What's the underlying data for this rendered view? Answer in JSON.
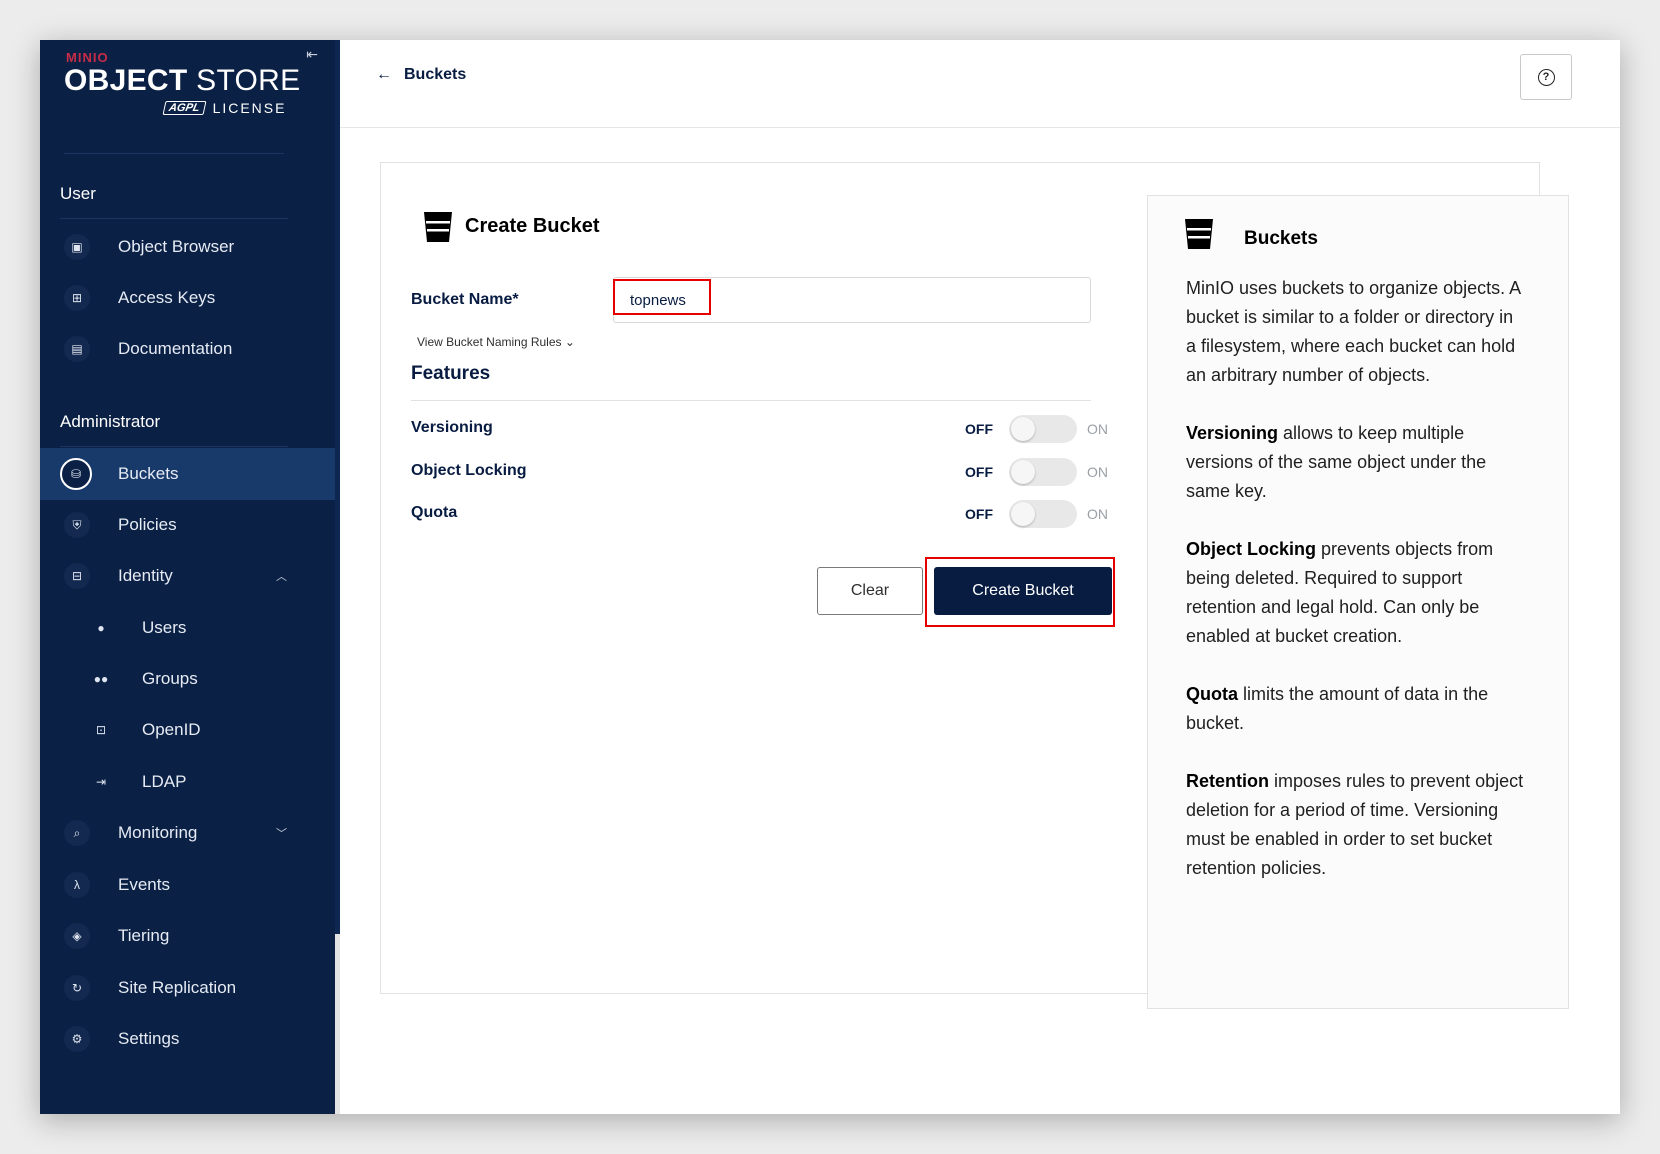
{
  "brand": {
    "minio": "MINIO",
    "object": "OBJECT",
    "store": "STORE",
    "agpl": "AGPL",
    "license": "LICENSE"
  },
  "sidebar": {
    "user_section": "User",
    "admin_section": "Administrator",
    "user_items": [
      {
        "label": "Object Browser",
        "icon": "object-browser-icon"
      },
      {
        "label": "Access Keys",
        "icon": "access-keys-icon"
      },
      {
        "label": "Documentation",
        "icon": "documentation-icon"
      }
    ],
    "admin_items": [
      {
        "label": "Buckets",
        "icon": "bucket-icon",
        "active": true
      },
      {
        "label": "Policies",
        "icon": "shield-icon"
      },
      {
        "label": "Identity",
        "icon": "identity-icon"
      },
      {
        "label": "Users",
        "icon": "user-icon"
      },
      {
        "label": "Groups",
        "icon": "groups-icon"
      },
      {
        "label": "OpenID",
        "icon": "lock-icon"
      },
      {
        "label": "LDAP",
        "icon": "login-icon"
      },
      {
        "label": "Monitoring",
        "icon": "monitoring-icon"
      },
      {
        "label": "Events",
        "icon": "lambda-icon"
      },
      {
        "label": "Tiering",
        "icon": "layers-icon"
      },
      {
        "label": "Site Replication",
        "icon": "replication-icon"
      },
      {
        "label": "Settings",
        "icon": "gear-icon"
      }
    ]
  },
  "header": {
    "back_label": "Buckets"
  },
  "form": {
    "title": "Create Bucket",
    "bucket_name_label": "Bucket Name*",
    "bucket_name_value": "topnews",
    "naming_rules_link": "View Bucket Naming Rules",
    "features_title": "Features",
    "features": [
      {
        "name": "Versioning",
        "off": "OFF",
        "on": "ON",
        "enabled": false
      },
      {
        "name": "Object Locking",
        "off": "OFF",
        "on": "ON",
        "enabled": false
      },
      {
        "name": "Quota",
        "off": "OFF",
        "on": "ON",
        "enabled": false
      }
    ],
    "clear_label": "Clear",
    "create_label": "Create Bucket"
  },
  "help": {
    "title": "Buckets",
    "intro": "MinIO uses buckets to organize objects. A bucket is similar to a folder or directory in a filesystem, where each bucket can hold an arbitrary number of objects.",
    "versioning_term": "Versioning",
    "versioning_text": " allows to keep multiple versions of the same object under the same key.",
    "locking_term": "Object Locking",
    "locking_text": " prevents objects from being deleted. Required to support retention and legal hold. Can only be enabled at bucket creation.",
    "quota_term": "Quota",
    "quota_text": " limits the amount of data in the bucket.",
    "retention_term": "Retention",
    "retention_text": " imposes rules to prevent object deletion for a period of time. Versioning must be enabled in order to set bucket retention policies."
  },
  "colors": {
    "sidebar_bg": "#0b2045",
    "active_item_bg": "#183a6b",
    "primary_button": "#081c42",
    "highlight": "#e60000"
  }
}
